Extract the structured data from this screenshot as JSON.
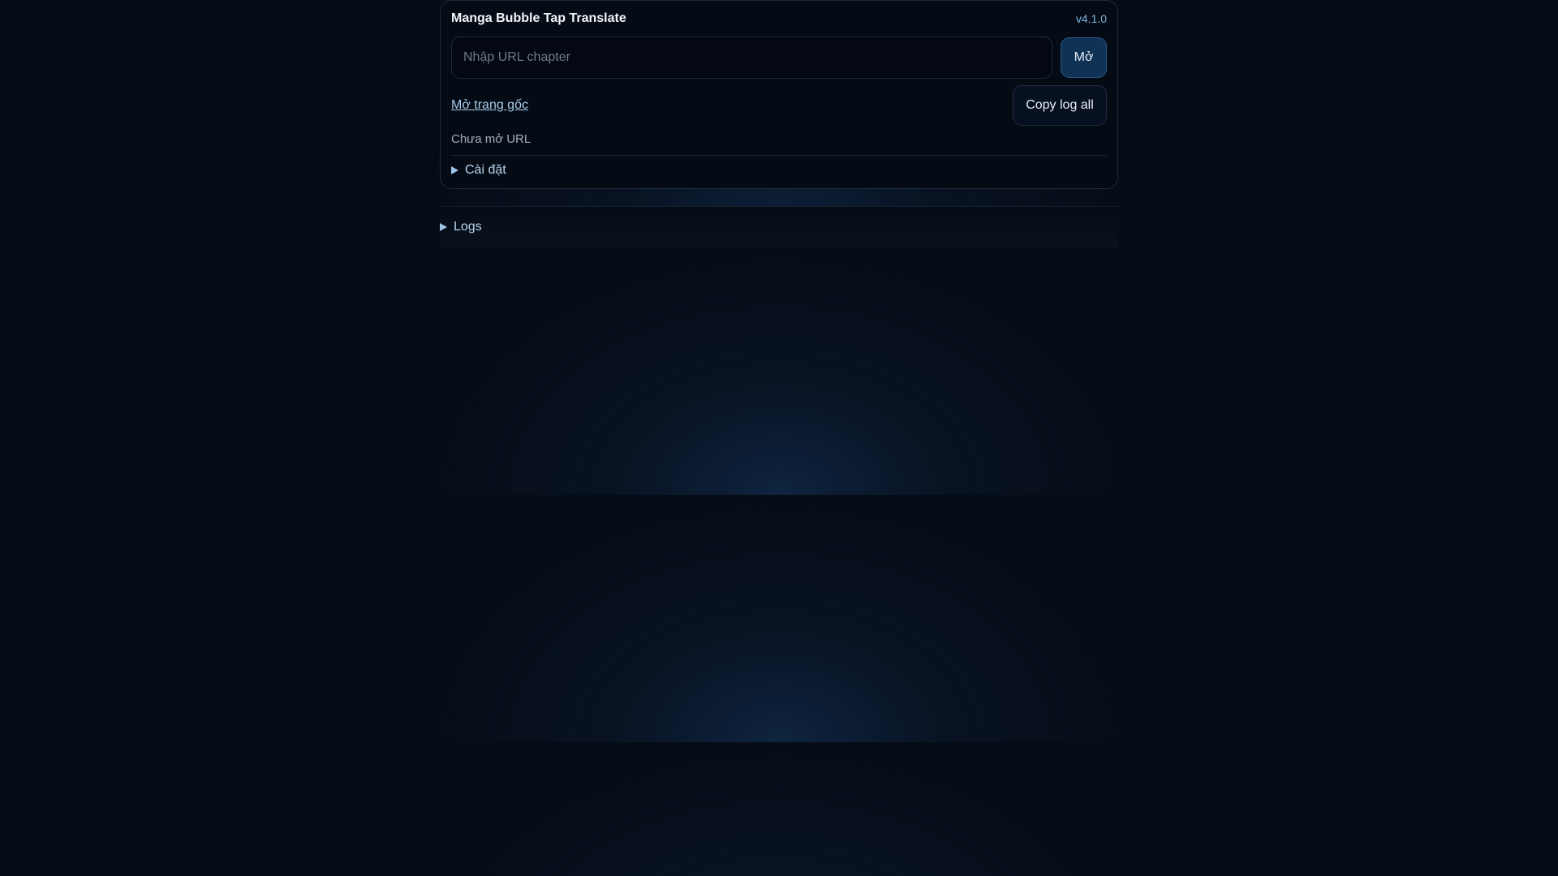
{
  "app": {
    "title": "Manga Bubble Tap Translate",
    "version": "v4.1.0"
  },
  "url_input": {
    "placeholder": "Nhập URL chapter",
    "value": ""
  },
  "buttons": {
    "open_label": "Mở",
    "copy_log_label": "Copy log all"
  },
  "links": {
    "open_origin_label": "Mở trang gốc"
  },
  "status": {
    "text": "Chưa mở URL"
  },
  "sections": {
    "settings_label": "Cài đặt",
    "logs_label": "Logs"
  },
  "colors": {
    "background": "#060c16",
    "accent": "#0f3255",
    "link": "#a9cce9",
    "version": "#7fb6e3"
  }
}
